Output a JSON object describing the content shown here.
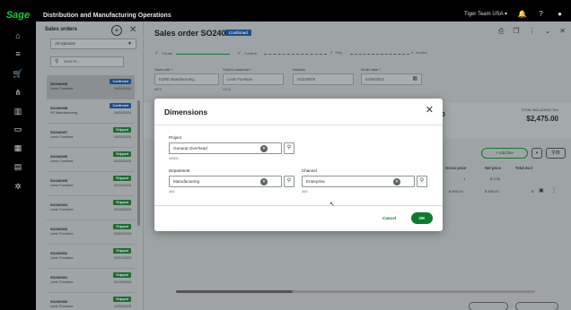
{
  "header": {
    "logo": "Sage",
    "app_title": "Distribution and Manufacturing Operations",
    "company": "Tiger Team USA ▾"
  },
  "orders_panel": {
    "title": "Sales orders",
    "status_filter": "All statuses",
    "search_placeholder": "Search...",
    "orders": [
      {
        "number": "SO240009",
        "customer": "Lenin Furniture",
        "status": "Confirmed",
        "date": "04/09/2024",
        "status_color": "#1b4e8c"
      },
      {
        "number": "SO240008",
        "customer": "PK Manufacturing",
        "status": "Confirmed",
        "date": "04/09/2024",
        "status_color": "#1b4e8c"
      },
      {
        "number": "SO240007",
        "customer": "Lenin Furniture",
        "status": "Shipped",
        "date": "03/20/2024",
        "status_color": "#1c6b33"
      },
      {
        "number": "SO240006",
        "customer": "Lenin Furniture",
        "status": "Shipped",
        "date": "03/19/2024",
        "status_color": "#1c6b33"
      },
      {
        "number": "SO240005",
        "customer": "Lenin Furniture",
        "status": "Shipped",
        "date": "03/14/2024",
        "status_color": "#1c6b33"
      },
      {
        "number": "SO240004",
        "customer": "Lenin Furniture",
        "status": "Shipped",
        "date": "03/13/2024",
        "status_color": "#1c6b33"
      },
      {
        "number": "SO240003",
        "customer": "Lenin Furniture",
        "status": "Shipped",
        "date": "03/02/2024",
        "status_color": "#1c6b33"
      },
      {
        "number": "SO240002",
        "customer": "Lenin Furniture",
        "status": "Shipped",
        "date": "02/21/2024",
        "status_color": "#1c6b33"
      },
      {
        "number": "SO240001",
        "customer": "Lenin Furniture",
        "status": "Shipped",
        "date": "02/15/2024",
        "status_color": "#1c6b33"
      },
      {
        "number": "SO230032",
        "customer": "Lenin Furniture",
        "status": "Shipped",
        "date": "12/20/2023",
        "status_color": "#1c6b33"
      }
    ]
  },
  "main": {
    "title": "Sales order SO240009",
    "status_badge": "Confirmed",
    "steps": [
      "Create",
      "Confirm",
      "Ship",
      "Invoice"
    ],
    "fields": {
      "sales_site_label": "Sales site *",
      "sales_site_value": "KORE Manufacturing",
      "sales_site_sub": "MFG",
      "sold_to_label": "Sold-to customer *",
      "sold_to_value": "Lenin Furniture",
      "sold_to_sub": "LEO1",
      "number_label": "Number",
      "number_value": "SO240009",
      "order_date_label": "Order date *",
      "order_date_value": "04/09/2024"
    },
    "totals": {
      "left_value": ".00",
      "right_label": "TOTAL INCLUDING TAX",
      "right_value": "$2,475.00"
    },
    "add_line_label": "+ Add line",
    "grid": {
      "headers": [
        "Gross price",
        "Net price",
        "Total excl"
      ],
      "row1": [
        "1",
        "$ 0.00",
        ""
      ],
      "row2": [
        "$ 495.00",
        "$ 495.00",
        "$"
      ]
    }
  },
  "dialog": {
    "title": "Dimensions",
    "project_label": "Project",
    "project_value": "General Overhead",
    "project_sub": "10000",
    "department_label": "Department",
    "department_value": "Manufacturing",
    "department_sub": "400",
    "channel_label": "Channel",
    "channel_value": "Enterprise",
    "channel_sub": "400",
    "cancel_label": "Cancel",
    "ok_label": "OK"
  },
  "colors": {
    "accent_green": "#0e7a2d",
    "confirmed_blue": "#1b4e8c",
    "shipped_green": "#1c6b33"
  }
}
